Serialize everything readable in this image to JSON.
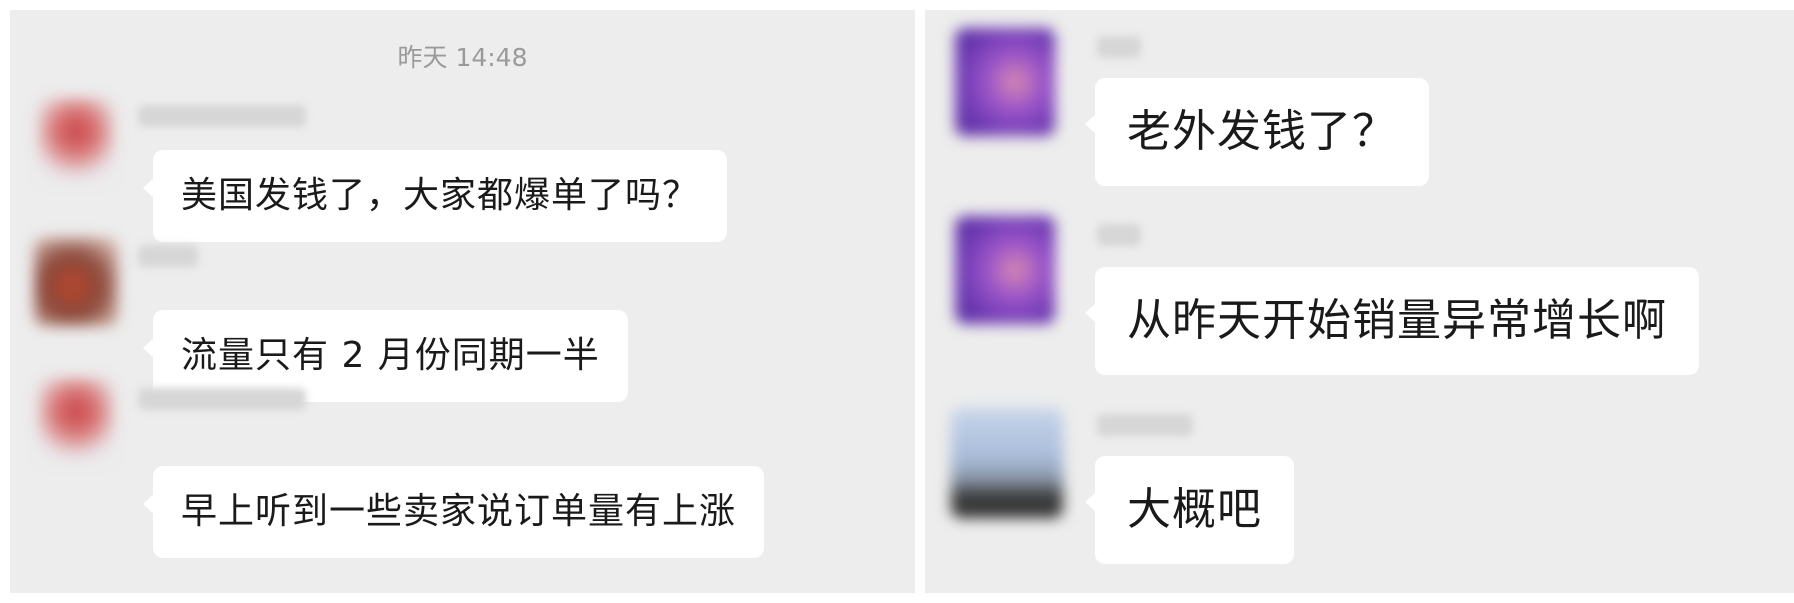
{
  "left_panel": {
    "timestamp": "昨天 14:48",
    "messages": [
      {
        "text": "美国发钱了，大家都爆单了吗？"
      },
      {
        "text": "流量只有 2 月份同期一半"
      },
      {
        "text": "早上听到一些卖家说订单量有上涨"
      }
    ]
  },
  "right_panel": {
    "messages": [
      {
        "text": "老外发钱了？"
      },
      {
        "text": "从昨天开始销量异常增长啊"
      },
      {
        "text": "大概吧"
      }
    ]
  },
  "colors": {
    "background": "#ededed",
    "bubble": "#ffffff",
    "text": "#1a1a1a",
    "timestamp": "#9a9a9a"
  },
  "icons": [
    "blurred-avatar"
  ]
}
